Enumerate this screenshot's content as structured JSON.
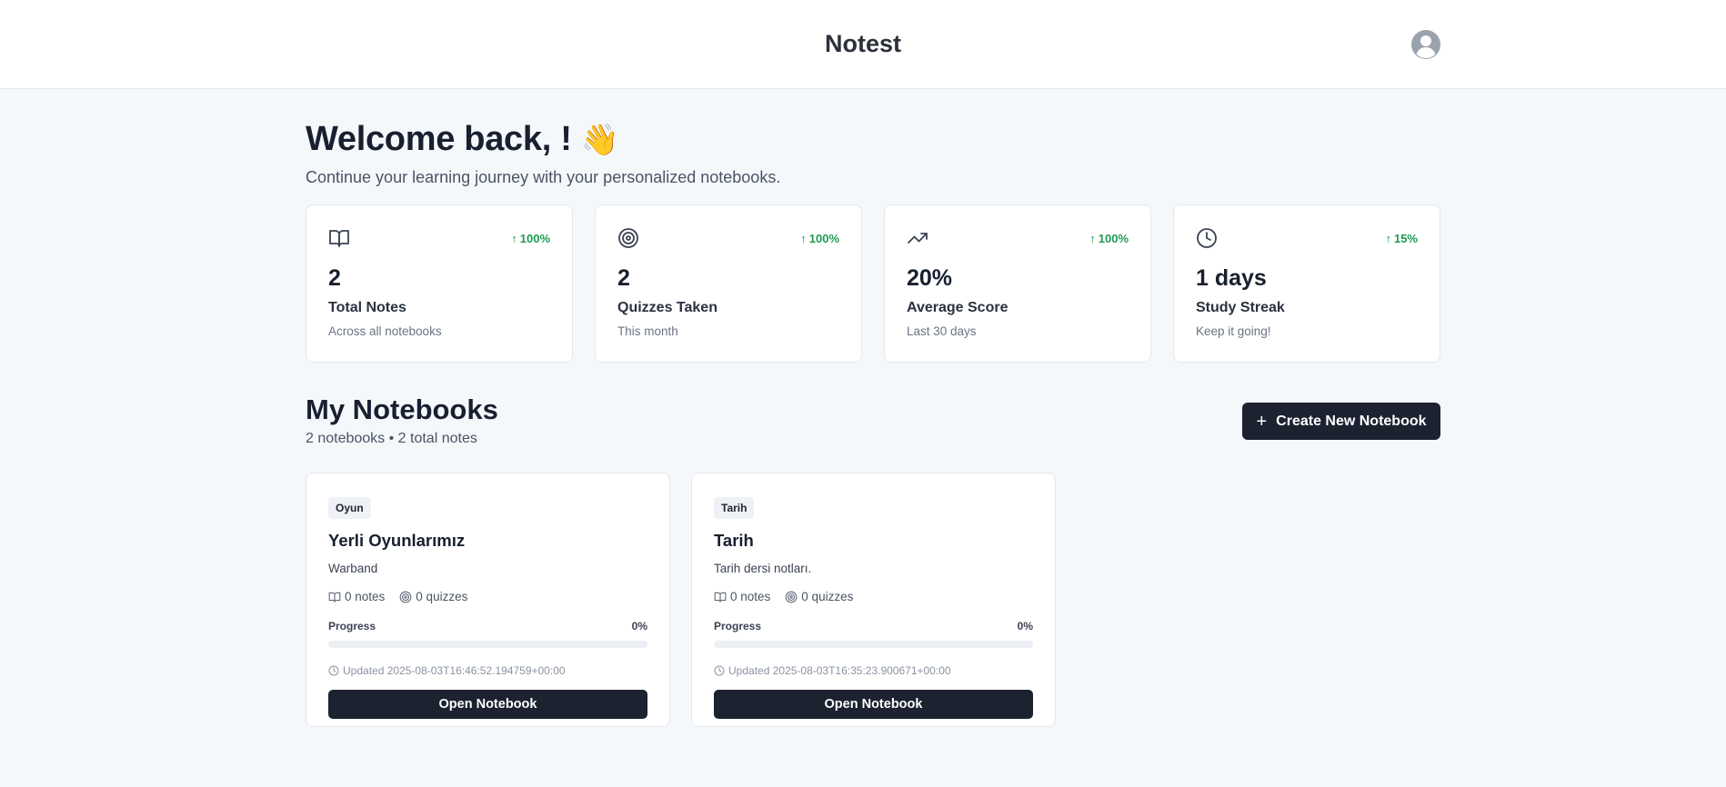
{
  "header": {
    "brand": "Notest",
    "avatar_icon": "user-circle-icon"
  },
  "welcome": {
    "title": "Welcome back, !",
    "emoji": "👋",
    "subtitle": "Continue your learning journey with your personalized notebooks."
  },
  "stats": [
    {
      "icon": "book-open-icon",
      "trend": "100%",
      "value": "2",
      "label": "Total Notes",
      "desc": "Across all notebooks"
    },
    {
      "icon": "target-icon",
      "trend": "100%",
      "value": "2",
      "label": "Quizzes Taken",
      "desc": "This month"
    },
    {
      "icon": "trending-up-icon",
      "trend": "100%",
      "value": "20%",
      "label": "Average Score",
      "desc": "Last 30 days"
    },
    {
      "icon": "clock-icon",
      "trend": "15%",
      "value": "1 days",
      "label": "Study Streak",
      "desc": "Keep it going!"
    }
  ],
  "notebooks_section": {
    "title": "My Notebooks",
    "subtitle": "2 notebooks • 2 total notes",
    "create_label": "Create New Notebook"
  },
  "notebooks": [
    {
      "tag": "Oyun",
      "title": "Yerli Oyunlarımız",
      "desc": "Warband",
      "notes": "0 notes",
      "quizzes": "0 quizzes",
      "progress_label": "Progress",
      "progress_text": "0%",
      "progress": 0,
      "updated": "Updated 2025-08-03T16:46:52.194759+00:00",
      "open_label": "Open Notebook"
    },
    {
      "tag": "Tarih",
      "title": "Tarih",
      "desc": "Tarih dersi notları.",
      "notes": "0 notes",
      "quizzes": "0 quizzes",
      "progress_label": "Progress",
      "progress_text": "0%",
      "progress": 0,
      "updated": "Updated 2025-08-03T16:35:23.900671+00:00",
      "open_label": "Open Notebook"
    }
  ],
  "colors": {
    "accent_dark": "#1c2230",
    "trend_green": "#1e9b54",
    "background": "#f5f8fb"
  }
}
